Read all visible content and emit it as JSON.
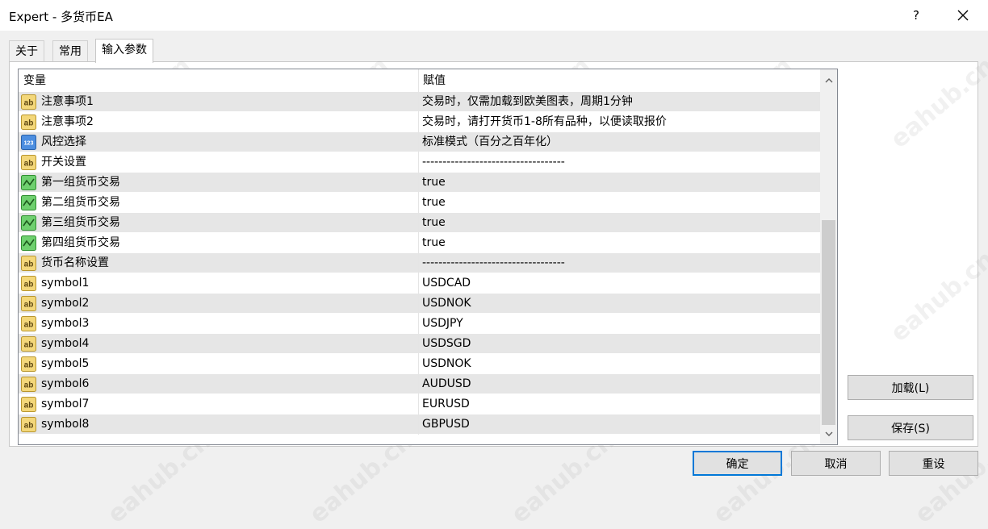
{
  "window": {
    "title": "Expert - 多货币EA",
    "help_label": "?"
  },
  "tabs": [
    {
      "label": "关于",
      "active": false
    },
    {
      "label": "常用",
      "active": false
    },
    {
      "label": "输入参数",
      "active": true
    }
  ],
  "grid": {
    "header": {
      "name": "变量",
      "value": "赋值"
    },
    "rows": [
      {
        "icon": "ab-string-icon",
        "name": "注意事项1",
        "value": "交易时，仅需加载到欧美图表，周期1分钟"
      },
      {
        "icon": "ab-string-icon",
        "name": "注意事项2",
        "value": "交易时，请打开货币1-8所有品种，以便读取报价"
      },
      {
        "icon": "123-number-icon",
        "name": "风控选择",
        "value": "标准模式（百分之百年化）"
      },
      {
        "icon": "ab-string-icon",
        "name": "开关设置",
        "value": "-----------------------------------"
      },
      {
        "icon": "bool-toggle-icon",
        "name": "第一组货币交易",
        "value": "true"
      },
      {
        "icon": "bool-toggle-icon",
        "name": "第二组货币交易",
        "value": "true"
      },
      {
        "icon": "bool-toggle-icon",
        "name": "第三组货币交易",
        "value": "true"
      },
      {
        "icon": "bool-toggle-icon",
        "name": "第四组货币交易",
        "value": "true"
      },
      {
        "icon": "ab-string-icon",
        "name": "货币名称设置",
        "value": "-----------------------------------"
      },
      {
        "icon": "ab-string-icon",
        "name": "symbol1",
        "value": "USDCAD"
      },
      {
        "icon": "ab-string-icon",
        "name": "symbol2",
        "value": "USDNOK"
      },
      {
        "icon": "ab-string-icon",
        "name": "symbol3",
        "value": "USDJPY"
      },
      {
        "icon": "ab-string-icon",
        "name": "symbol4",
        "value": "USDSGD"
      },
      {
        "icon": "ab-string-icon",
        "name": "symbol5",
        "value": "USDNOK"
      },
      {
        "icon": "ab-string-icon",
        "name": "symbol6",
        "value": "AUDUSD"
      },
      {
        "icon": "ab-string-icon",
        "name": "symbol7",
        "value": "EURUSD"
      },
      {
        "icon": "ab-string-icon",
        "name": "symbol8",
        "value": "GBPUSD"
      }
    ]
  },
  "side_buttons": {
    "load_label": "加载(L)",
    "save_label": "保存(S)"
  },
  "footer_buttons": {
    "ok_label": "确定",
    "cancel_label": "取消",
    "reset_label": "重设"
  },
  "watermark": {
    "text": "eahub.cn"
  },
  "colors": {
    "accent": "#0078d7",
    "ab_icon": "#e8c86a",
    "num_icon": "#3a7fd0",
    "bool_icon": "#5cc05c"
  }
}
